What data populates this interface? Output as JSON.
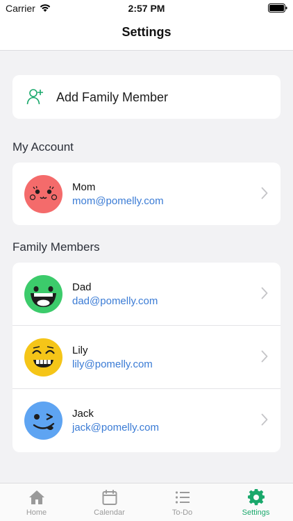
{
  "status_bar": {
    "carrier": "Carrier",
    "time": "2:57 PM"
  },
  "nav": {
    "title": "Settings"
  },
  "add_member": {
    "label": "Add Family Member"
  },
  "sections": {
    "my_account": "My Account",
    "family_members": "Family Members"
  },
  "account": {
    "name": "Mom",
    "email": "mom@pomelly.com",
    "avatar_color": "#f46b6b"
  },
  "family": [
    {
      "name": "Dad",
      "email": "dad@pomelly.com",
      "avatar_color": "#3ccb6b"
    },
    {
      "name": "Lily",
      "email": "lily@pomelly.com",
      "avatar_color": "#f5c518"
    },
    {
      "name": "Jack",
      "email": "jack@pomelly.com",
      "avatar_color": "#5ea4f2"
    }
  ],
  "tabs": [
    {
      "label": "Home",
      "icon": "home-icon"
    },
    {
      "label": "Calendar",
      "icon": "calendar-icon"
    },
    {
      "label": "To-Do",
      "icon": "list-icon"
    },
    {
      "label": "Settings",
      "icon": "gear-icon",
      "active": true
    }
  ],
  "colors": {
    "accent": "#19a86b",
    "link": "#3a7bd5"
  }
}
